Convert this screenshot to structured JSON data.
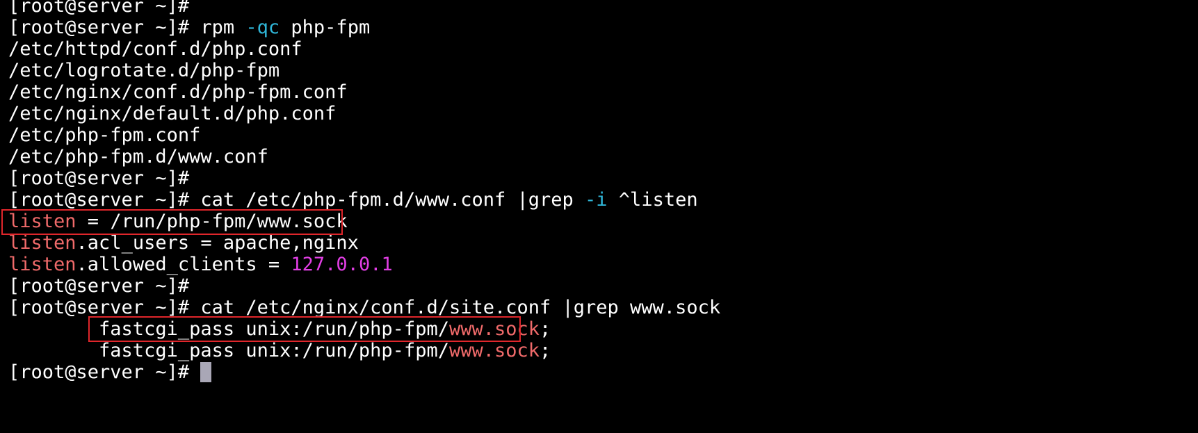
{
  "terminal": {
    "colors": {
      "background": "#000000",
      "text": "#ffffff",
      "option": "#2fb6d8",
      "directive": "#f06a6a",
      "number": "#e13ee4",
      "highlight_box": "#e0262b",
      "cursor": "#a9a7b6"
    },
    "lines": [
      {
        "segments": [
          {
            "text": "[root@server ~]#",
            "color": "white"
          }
        ]
      },
      {
        "segments": [
          {
            "text": "[root@server ~]# rpm ",
            "color": "white"
          },
          {
            "text": "-qc",
            "color": "cyan"
          },
          {
            "text": " php-fpm",
            "color": "white"
          }
        ]
      },
      {
        "segments": [
          {
            "text": "/etc/httpd/conf.d/php.conf",
            "color": "white"
          }
        ]
      },
      {
        "segments": [
          {
            "text": "/etc/logrotate.d/php-fpm",
            "color": "white"
          }
        ]
      },
      {
        "segments": [
          {
            "text": "/etc/nginx/conf.d/php-fpm.conf",
            "color": "white"
          }
        ]
      },
      {
        "segments": [
          {
            "text": "/etc/nginx/default.d/php.conf",
            "color": "white"
          }
        ]
      },
      {
        "segments": [
          {
            "text": "/etc/php-fpm.conf",
            "color": "white"
          }
        ]
      },
      {
        "segments": [
          {
            "text": "/etc/php-fpm.d/www.conf",
            "color": "white"
          }
        ]
      },
      {
        "segments": [
          {
            "text": "[root@server ~]#",
            "color": "white"
          }
        ]
      },
      {
        "segments": [
          {
            "text": "[root@server ~]# cat /etc/php-fpm.d/www.conf |grep ",
            "color": "white"
          },
          {
            "text": "-i",
            "color": "cyan"
          },
          {
            "text": " ^listen",
            "color": "white"
          }
        ]
      },
      {
        "segments": [
          {
            "text": "listen",
            "color": "red"
          },
          {
            "text": " = /run/php-fpm/www.sock",
            "color": "white"
          }
        ]
      },
      {
        "segments": [
          {
            "text": "listen",
            "color": "red"
          },
          {
            "text": ".acl_users = apache,nginx",
            "color": "white"
          }
        ]
      },
      {
        "segments": [
          {
            "text": "listen",
            "color": "red"
          },
          {
            "text": ".allowed_clients = ",
            "color": "white"
          },
          {
            "text": "127.0.0.1",
            "color": "magenta"
          }
        ]
      },
      {
        "segments": [
          {
            "text": "[root@server ~]#",
            "color": "white"
          }
        ]
      },
      {
        "segments": [
          {
            "text": "[root@server ~]# cat /etc/nginx/conf.d/site.conf |grep www.sock",
            "color": "white"
          }
        ]
      },
      {
        "segments": [
          {
            "text": "        fastcgi_pass unix:/run/php-fpm/",
            "color": "white"
          },
          {
            "text": "www.sock",
            "color": "red"
          },
          {
            "text": ";",
            "color": "white"
          }
        ]
      },
      {
        "segments": [
          {
            "text": "        fastcgi_pass unix:/run/php-fpm/",
            "color": "white"
          },
          {
            "text": "www.sock",
            "color": "red"
          },
          {
            "text": ";",
            "color": "white"
          }
        ]
      },
      {
        "segments": [
          {
            "text": "[root@server ~]# ",
            "color": "white"
          }
        ],
        "cursor": true
      }
    ]
  }
}
